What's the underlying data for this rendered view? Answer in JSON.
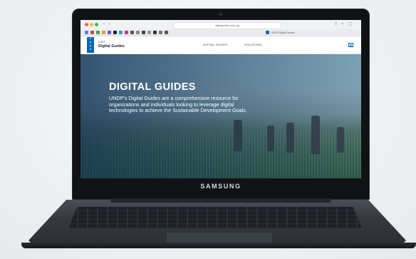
{
  "device": {
    "brand_label": "SAMSUNG"
  },
  "browser": {
    "url": "digitalguides.undp.org",
    "active_tab_title": "UNDP Digital Guides"
  },
  "site": {
    "logo_text": [
      "U",
      "N",
      "D",
      "P"
    ],
    "subtitle": "UNDP",
    "name": "Digital Guides",
    "nav": [
      {
        "label": "DIGITAL GUIDES"
      },
      {
        "label": "SOLUTIONS"
      }
    ]
  },
  "hero": {
    "title": "DIGITAL GUIDES",
    "description": "UNDP's Digital Guides are a comprehensive resource for organizations and individuals looking to leverage digital technologies to achieve the Sustainable Development Goals."
  },
  "colors": {
    "brand_blue": "#0468b1",
    "hero_overlay": "#112f50"
  }
}
